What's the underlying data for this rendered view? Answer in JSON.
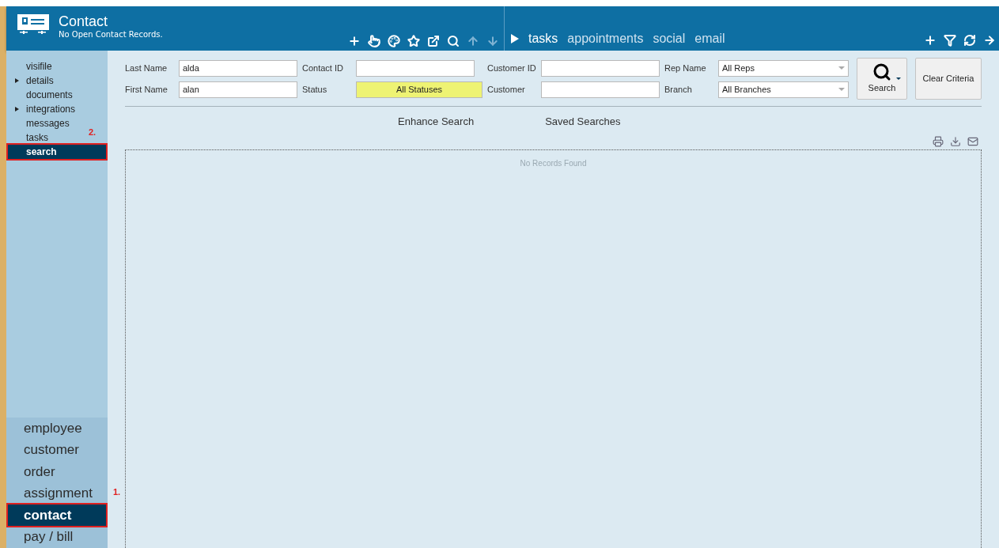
{
  "header": {
    "title": "Contact",
    "subtitle": "No Open Contact Records.",
    "tools": [
      {
        "kind": "plus",
        "disabled": false
      },
      {
        "kind": "hand",
        "disabled": false
      },
      {
        "kind": "palette",
        "disabled": false
      },
      {
        "kind": "star",
        "disabled": false
      },
      {
        "kind": "external",
        "disabled": false
      },
      {
        "kind": "search",
        "disabled": false
      },
      {
        "kind": "up",
        "disabled": true
      },
      {
        "kind": "down",
        "disabled": true
      }
    ],
    "tabs": [
      {
        "label": "tasks",
        "selected": true
      },
      {
        "label": "appointments",
        "selected": false
      },
      {
        "label": "social",
        "selected": false
      },
      {
        "label": "email",
        "selected": false
      }
    ],
    "right_tools": [
      {
        "kind": "plus"
      },
      {
        "kind": "filter"
      },
      {
        "kind": "refresh"
      },
      {
        "kind": "arrow"
      }
    ]
  },
  "sidebar": {
    "items": [
      {
        "label": "visifile",
        "kind": "link",
        "selected": false
      },
      {
        "label": "details",
        "kind": "group",
        "selected": false
      },
      {
        "label": "documents",
        "kind": "link",
        "selected": false
      },
      {
        "label": "integrations",
        "kind": "group",
        "selected": false
      },
      {
        "label": "messages",
        "kind": "link",
        "selected": false
      },
      {
        "label": "tasks",
        "kind": "link",
        "selected": false
      },
      {
        "label": "search",
        "kind": "link",
        "selected": true,
        "callout": "2."
      }
    ],
    "modules": [
      {
        "label": "employee",
        "selected": false
      },
      {
        "label": "customer",
        "selected": false
      },
      {
        "label": "order",
        "selected": false
      },
      {
        "label": "assignment",
        "selected": false
      },
      {
        "label": "contact",
        "selected": true,
        "callout": "1."
      },
      {
        "label": "pay / bill",
        "selected": false
      }
    ]
  },
  "form": {
    "fields": [
      {
        "label": "Last Name",
        "value": "alda",
        "kind": "text"
      },
      {
        "label": "Contact ID",
        "kind": "text"
      },
      {
        "label": "Customer ID",
        "kind": "text"
      },
      {
        "label": "Rep Name",
        "value": "All Reps",
        "kind": "select"
      },
      {
        "label": "First Name",
        "value": "alan",
        "kind": "text"
      },
      {
        "label": "Status",
        "value": "All Statuses",
        "kind": "status"
      },
      {
        "label": "Customer",
        "kind": "text"
      },
      {
        "label": "Branch",
        "value": "All Branches",
        "kind": "select"
      }
    ],
    "search_button": "Search",
    "clear_button": "Clear Criteria"
  },
  "links": [
    "Enhance Search",
    "Saved Searches"
  ],
  "results": {
    "empty_text": "No Records Found"
  }
}
